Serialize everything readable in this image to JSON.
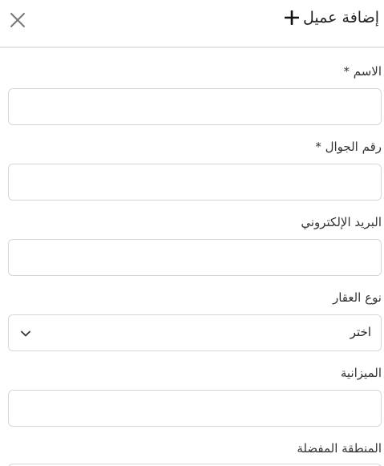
{
  "header": {
    "title": "إضافة عميل",
    "close_icon": "close-icon",
    "plus_icon": "plus-icon"
  },
  "fields": {
    "name": {
      "label": "الاسم *",
      "value": "",
      "placeholder": ""
    },
    "mobile": {
      "label": "رقم الجوال *",
      "value": "",
      "placeholder": ""
    },
    "email": {
      "label": "البريد الإلكتروني",
      "value": "",
      "placeholder": ""
    },
    "property_type": {
      "label": "نوع العقار",
      "selected": "اختر"
    },
    "budget": {
      "label": "الميزانية",
      "value": "",
      "placeholder": ""
    },
    "preferred_area": {
      "label": "المنطقة المفضلة"
    }
  },
  "colors": {
    "border": "#d7d7d7",
    "divider": "#e4e4e4",
    "text": "#222222"
  }
}
